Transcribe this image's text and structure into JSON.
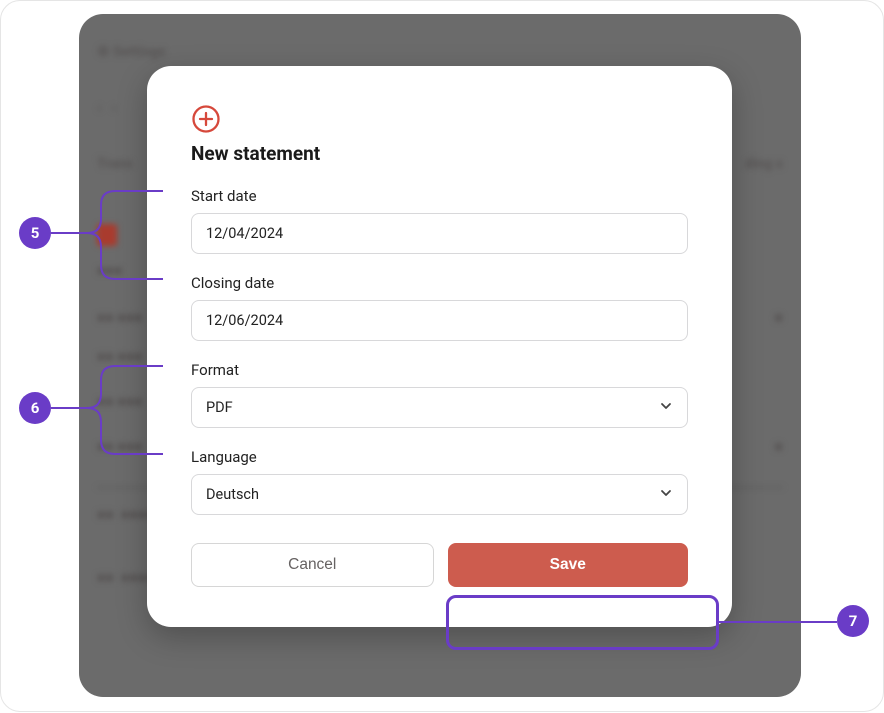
{
  "backdrop": {
    "settings_label": "⚙ Settings",
    "trans_label": "Trans",
    "ding_label": "ding s"
  },
  "modal": {
    "title": "New statement",
    "start_date": {
      "label": "Start date",
      "value": "12/04/2024"
    },
    "closing_date": {
      "label": "Closing date",
      "value": "12/06/2024"
    },
    "format": {
      "label": "Format",
      "value": "PDF"
    },
    "language": {
      "label": "Language",
      "value": "Deutsch"
    },
    "buttons": {
      "cancel": "Cancel",
      "save": "Save"
    }
  },
  "callouts": {
    "c5": "5",
    "c6": "6",
    "c7": "7"
  }
}
